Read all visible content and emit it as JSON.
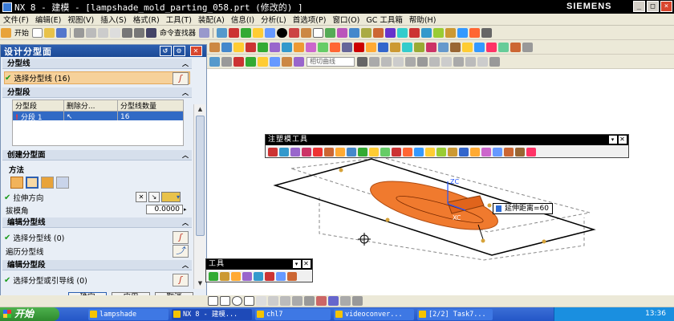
{
  "window": {
    "title": "NX 8 - 建模 - [lampshade_mold_parting_058.prt  (修改的) ]",
    "brand": "SIEMENS",
    "controls": [
      "_",
      "□",
      "×"
    ]
  },
  "menubar": [
    "文件(F)",
    "编辑(E)",
    "视图(V)",
    "插入(S)",
    "格式(R)",
    "工具(T)",
    "装配(A)",
    "信息(I)",
    "分析(L)",
    "首选项(P)",
    "窗口(O)",
    "GC 工具箱",
    "帮助(H)"
  ],
  "toolbar": {
    "start_label": "开始",
    "command_finder_label": "命令查找器",
    "selection_box_placeholder": "相切曲线"
  },
  "dialog": {
    "title": "设计分型面",
    "sections": {
      "parting_lines": "分型线",
      "segments": "分型段",
      "create_surface": "创建分型面",
      "method": "方法",
      "edit_lines": "编辑分型线",
      "edit_segments": "编辑分型段"
    },
    "select_parting_lines_top": "选择分型线 (16)",
    "segment_table": {
      "headers": [
        "分型段",
        "删除分...",
        "分型线数量"
      ],
      "rows": [
        {
          "name": "分段 1",
          "count": "16"
        }
      ]
    },
    "extrude_direction": "拉伸方向",
    "draft_angle_label": "拔模角",
    "draft_angle_value": "0.0000",
    "select_parting_lines": "选择分型线 (0)",
    "traverse_lines": "遍历分型线",
    "select_segment_or_guide": "选择分型或引导线 (0)",
    "buttons": {
      "ok": "确定",
      "apply": "应用",
      "cancel": "取消"
    }
  },
  "viewport": {
    "injection_mold_toolbar_title": "注塑模工具",
    "second_toolbar_title": "工具",
    "extend_distance_label": "延伸距离=60",
    "coord_label": "XC"
  },
  "taskbar": {
    "start": "开始",
    "tasks": [
      "lampshade",
      "NX 8 - 建模...",
      "chl7",
      "videoconver...",
      "[2/2] Task7..."
    ],
    "clock": "13:36"
  },
  "colors": {
    "title_bar": "#000000",
    "dialog_header": "#1c4a96",
    "selected_row": "#316ac5",
    "part_orange": "#f07a2e",
    "taskbar": "#2456c7"
  }
}
